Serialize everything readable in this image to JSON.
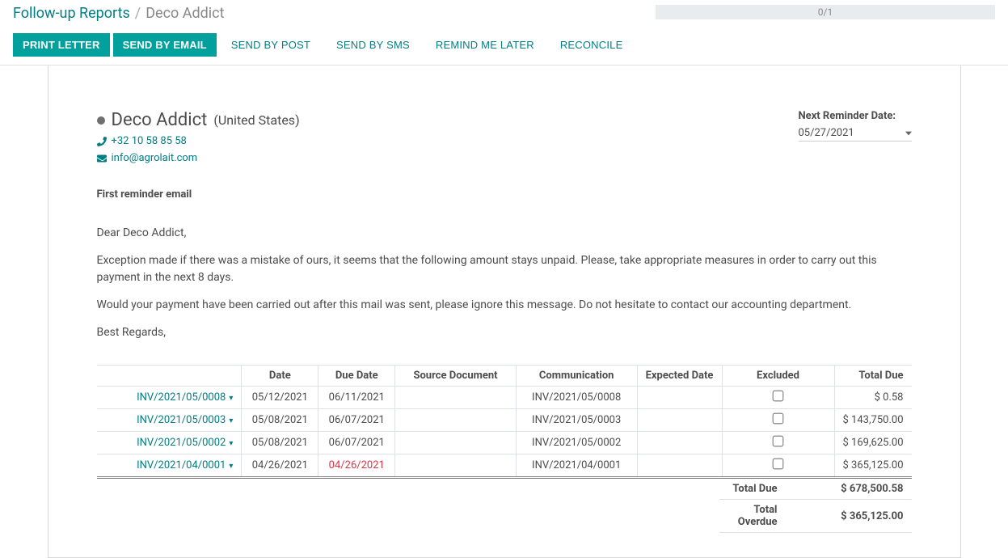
{
  "breadcrumb": {
    "root": "Follow-up Reports",
    "current": "Deco Addict"
  },
  "pager": "0/1",
  "actions": {
    "print_letter": "PRINT LETTER",
    "send_email": "SEND BY EMAIL",
    "send_post": "SEND BY POST",
    "send_sms": "SEND BY SMS",
    "remind_later": "REMIND ME LATER",
    "reconcile": "RECONCILE"
  },
  "partner": {
    "name": "Deco Addict",
    "country": "(United States)",
    "phone": "+32 10 58 85 58",
    "email": "info@agrolait.com"
  },
  "reminder": {
    "label": "Next Reminder Date:",
    "date": "05/27/2021"
  },
  "subject": "First reminder email",
  "body": {
    "p1": "Dear Deco Addict,",
    "p2": "Exception made if there was a mistake of ours, it seems that the following amount stays unpaid. Please, take appropriate measures in order to carry out this payment in the next 8 days.",
    "p3": "Would your payment have been carried out after this mail was sent, please ignore this message. Do not hesitate to contact our accounting department.",
    "p4": "Best Regards,"
  },
  "table": {
    "headers": {
      "invoice": "",
      "date": "Date",
      "due_date": "Due Date",
      "source": "Source Document",
      "communication": "Communication",
      "expected": "Expected Date",
      "excluded": "Excluded",
      "total_due": "Total Due"
    },
    "rows": [
      {
        "inv": "INV/2021/05/0008",
        "date": "05/12/2021",
        "due": "06/11/2021",
        "overdue": false,
        "comm": "INV/2021/05/0008",
        "amount": "$ 0.58"
      },
      {
        "inv": "INV/2021/05/0003",
        "date": "05/08/2021",
        "due": "06/07/2021",
        "overdue": false,
        "comm": "INV/2021/05/0003",
        "amount": "$ 143,750.00"
      },
      {
        "inv": "INV/2021/05/0002",
        "date": "05/08/2021",
        "due": "06/07/2021",
        "overdue": false,
        "comm": "INV/2021/05/0002",
        "amount": "$ 169,625.00"
      },
      {
        "inv": "INV/2021/04/0001",
        "date": "04/26/2021",
        "due": "04/26/2021",
        "overdue": true,
        "comm": "INV/2021/04/0001",
        "amount": "$ 365,125.00"
      }
    ]
  },
  "totals": {
    "total_due_label": "Total Due",
    "total_due_amount": "$ 678,500.58",
    "total_overdue_label": "Total Overdue",
    "total_overdue_amount": "$ 365,125.00"
  }
}
